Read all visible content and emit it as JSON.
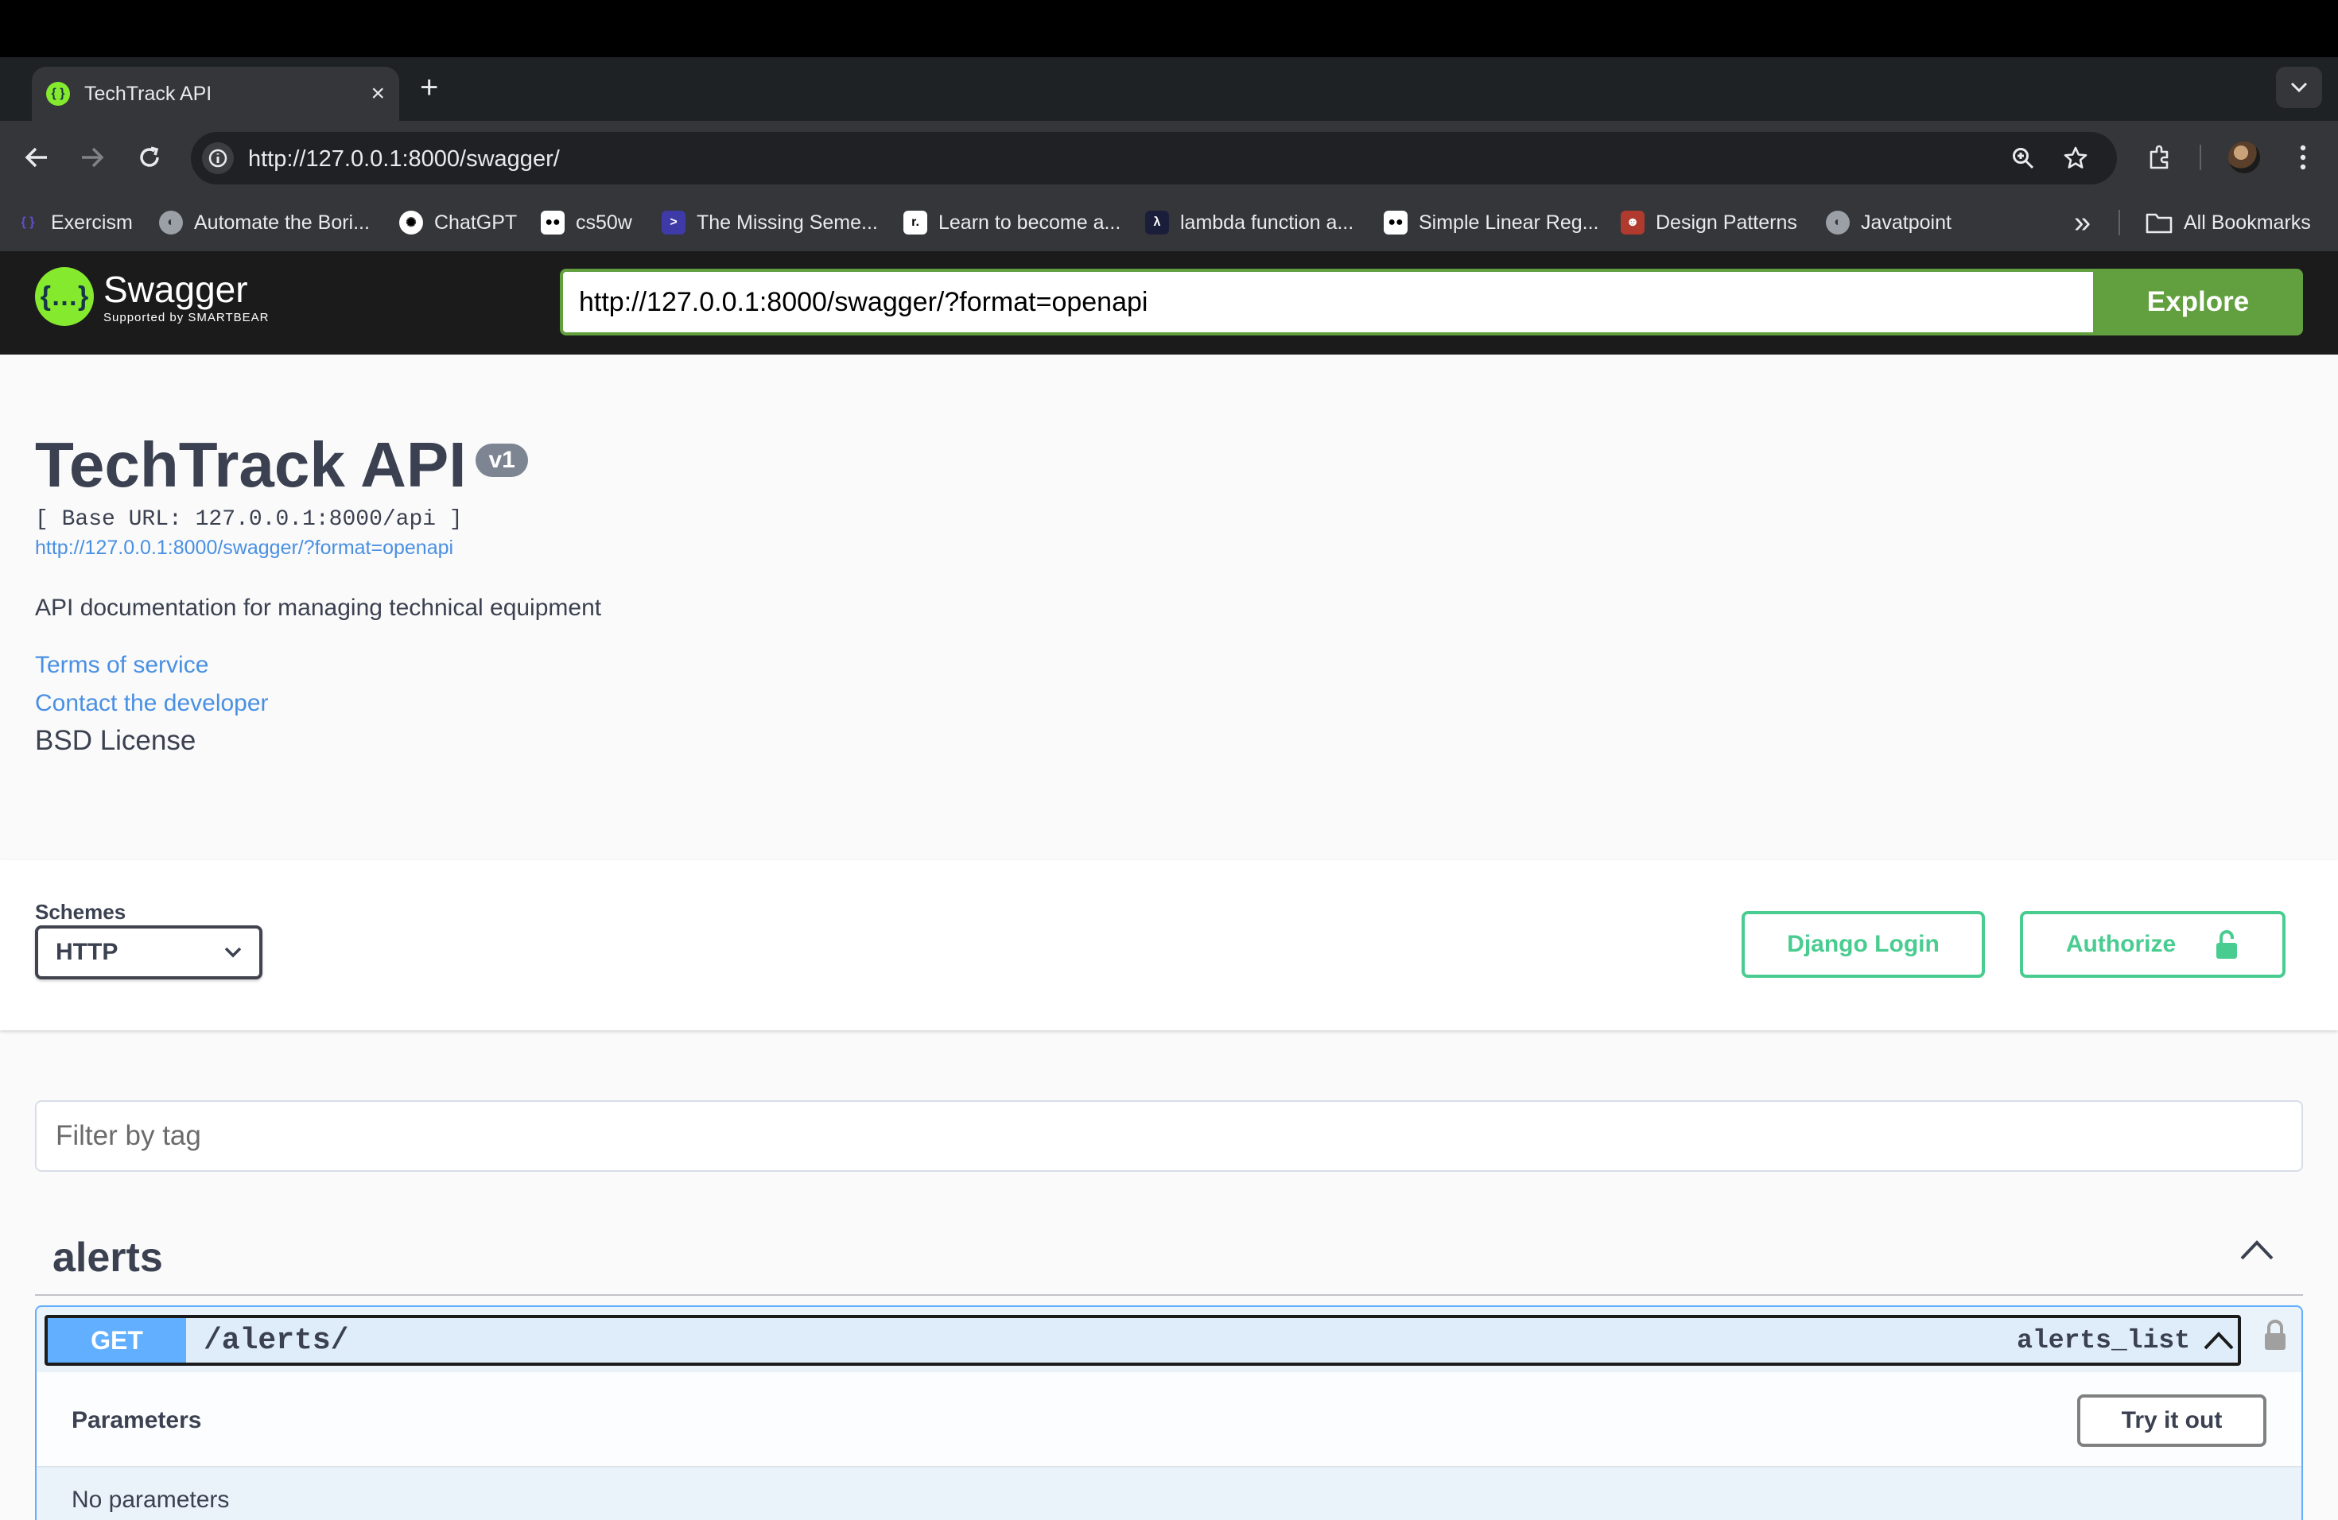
{
  "browser": {
    "tab_title": "TechTrack API",
    "tab_close": "×",
    "new_tab": "+",
    "url": "http://127.0.0.1:8000/swagger/"
  },
  "bookmarks": [
    {
      "label": "Exercism",
      "icon": "exercism-icon",
      "color": "#604fcd"
    },
    {
      "label": "Automate the Bori...",
      "icon": "globe-icon",
      "color": "#9aa0a6"
    },
    {
      "label": "ChatGPT",
      "icon": "chatgpt-icon",
      "color": "#ffffff"
    },
    {
      "label": "cs50w",
      "icon": "medium-icon",
      "color": "#ffffff"
    },
    {
      "label": "The Missing Seme...",
      "icon": "terminal-icon",
      "color": "#3e3aa8"
    },
    {
      "label": "Learn to become a...",
      "icon": "roadmap-icon",
      "color": "#ffffff"
    },
    {
      "label": "lambda function a...",
      "icon": "lambda-icon",
      "color": "#1b1e3a"
    },
    {
      "label": "Simple Linear Reg...",
      "icon": "medium-icon",
      "color": "#ffffff"
    },
    {
      "label": "Design Patterns",
      "icon": "refactoring-guru-icon",
      "color": "#b03a2e"
    },
    {
      "label": "Javatpoint",
      "icon": "globe-icon",
      "color": "#9aa0a6"
    }
  ],
  "bookmarks_overflow": "»",
  "all_bookmarks": "All Bookmarks",
  "swagger_topbar": {
    "logo_word": "Swagger",
    "logo_sub": "Supported by SMARTBEAR",
    "spec_url": "http://127.0.0.1:8000/swagger/?format=openapi",
    "explore_label": "Explore"
  },
  "info": {
    "title": "TechTrack API",
    "version": "v1",
    "base_url": "[ Base URL: 127.0.0.1:8000/api ]",
    "spec_link": "http://127.0.0.1:8000/swagger/?format=openapi",
    "description": "API documentation for managing technical equipment",
    "terms": "Terms of service",
    "contact": "Contact the developer",
    "license": "BSD License"
  },
  "schemes": {
    "label": "Schemes",
    "selected": "HTTP",
    "django_login": "Django Login",
    "authorize": "Authorize"
  },
  "filter": {
    "placeholder": "Filter by tag"
  },
  "tag": {
    "name": "alerts",
    "operation": {
      "method": "GET",
      "path": "/alerts/",
      "operation_id": "alerts_list",
      "parameters_title": "Parameters",
      "try_it_out": "Try it out",
      "no_parameters": "No parameters"
    }
  },
  "colors": {
    "swagger_green": "#85ea2d",
    "explore_green": "#62a03f",
    "authorize_green": "#49cc90",
    "get_blue": "#61affe",
    "link_blue": "#4990e2",
    "text": "#3b4151"
  }
}
